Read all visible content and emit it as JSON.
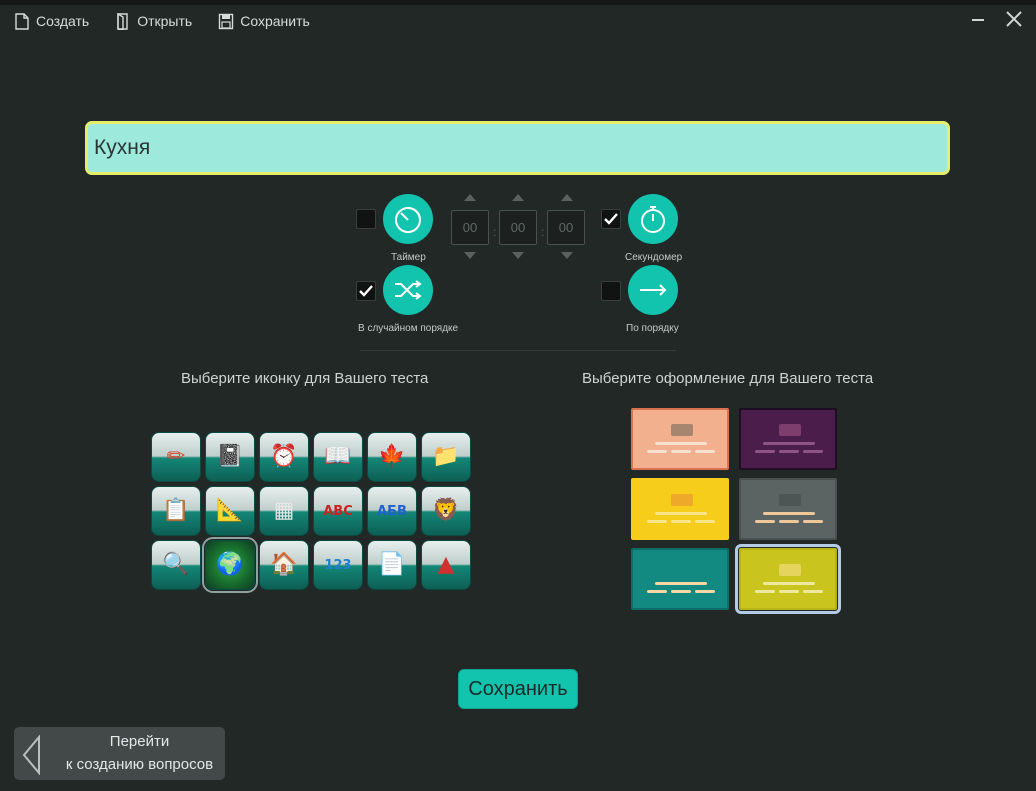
{
  "toolbar": {
    "create_label": "Создать",
    "open_label": "Открыть",
    "save_label": "Сохранить"
  },
  "test_title": "Кухня",
  "options": {
    "timer": {
      "label": "Таймер",
      "checked": false
    },
    "stopwatch": {
      "label": "Секундомер",
      "checked": true
    },
    "random_order": {
      "label": "В случайном порядке",
      "checked": true
    },
    "sequential_order": {
      "label": "По порядку",
      "checked": false
    },
    "time": {
      "hours": "00",
      "minutes": "00",
      "seconds": "00"
    }
  },
  "icon_section_title": "Выберите иконку для Вашего теста",
  "theme_section_title": "Выберите оформление для Вашего теста",
  "icons": [
    {
      "name": "pencils-icon",
      "glyph": "✏"
    },
    {
      "name": "notebook-icon",
      "glyph": "📓"
    },
    {
      "name": "alarm-clock-icon",
      "glyph": "⏰"
    },
    {
      "name": "open-book-icon",
      "glyph": "📖"
    },
    {
      "name": "autumn-leaves-icon",
      "glyph": "🍁"
    },
    {
      "name": "folders-icon",
      "glyph": "📁"
    },
    {
      "name": "clipboard-icon",
      "glyph": "📋"
    },
    {
      "name": "globe-ruler-icon",
      "glyph": "📐"
    },
    {
      "name": "chalkboard-icon",
      "glyph": "▦"
    },
    {
      "name": "abc-latin-icon",
      "glyph": "ABC"
    },
    {
      "name": "abc-cyrillic-icon",
      "glyph": "АБВ"
    },
    {
      "name": "picture-book-icon",
      "glyph": "🦁"
    },
    {
      "name": "magnifier-paper-icon",
      "glyph": "🔍"
    },
    {
      "name": "globe-icon",
      "glyph": "🌍"
    },
    {
      "name": "drawing-icon",
      "glyph": "🏠"
    },
    {
      "name": "numbers-icon",
      "glyph": "123"
    },
    {
      "name": "papers-pencils-icon",
      "glyph": "📄"
    },
    {
      "name": "geometric-shapes-icon",
      "glyph": "▲"
    }
  ],
  "selected_icon": "globe-icon",
  "themes": [
    {
      "name": "theme-peach",
      "bg": "#f3b08f",
      "border": "#d9734f",
      "block": "#a7866f",
      "bars": "#f7e0cf"
    },
    {
      "name": "theme-purple-night",
      "bg": "#4b1d4b",
      "border": "#1d0e22",
      "block": "#7d3e6e",
      "bars": "#8d5485"
    },
    {
      "name": "theme-yellow",
      "bg": "#f6cd1a",
      "border": "#f6cd1a",
      "block": "#eea82a",
      "bars": "#fbe58a"
    },
    {
      "name": "theme-slate",
      "bg": "#5b6463",
      "border": "#485150",
      "block": "#4d5655",
      "bars": "#eec79b"
    },
    {
      "name": "theme-teal",
      "bg": "#128a82",
      "border": "#0e6e68",
      "block": "#128a82",
      "bars": "#f4d7a7"
    },
    {
      "name": "theme-lime",
      "bg": "#c9c51e",
      "border": "#b7b31a",
      "block": "#e5d45d",
      "bars": "#efe9a0"
    }
  ],
  "selected_theme": "theme-lime",
  "save_button_label": "Сохранить",
  "back_button": {
    "line1": "Перейти",
    "line2": "к созданию вопросов"
  },
  "colors": {
    "background": "#222826",
    "accent": "#12c3ad",
    "title_field": "#9de9dc",
    "title_border": "#e7ec6c"
  }
}
